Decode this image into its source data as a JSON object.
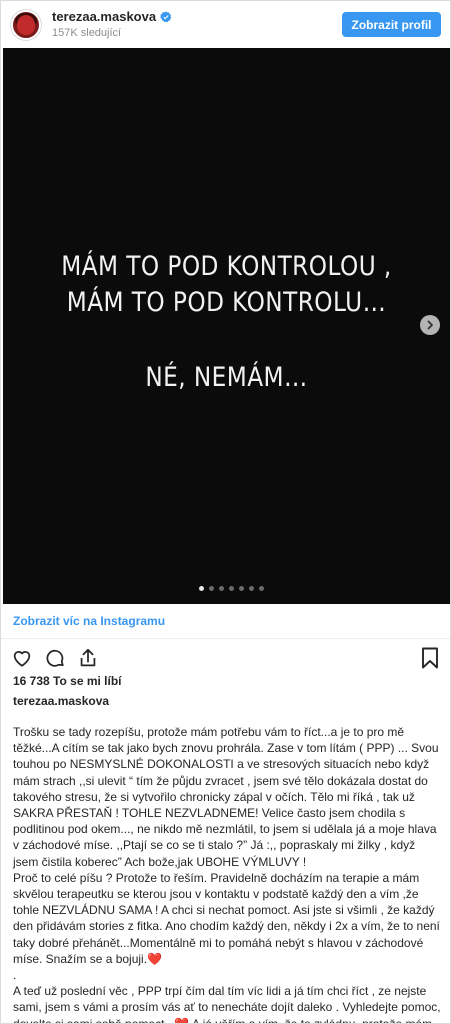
{
  "header": {
    "username": "terezaa.maskova",
    "followers": "157K sledující",
    "profile_button": "Zobrazit profil"
  },
  "slide": {
    "line1": "MÁM TO POD KONTROLOU ,",
    "line2": "MÁM TO POD KONTROLU…",
    "line3": "NÉ, NEMÁM…",
    "dot_count": 7,
    "active_dot": 1
  },
  "view_more": "Zobrazit víc na Instagramu",
  "likes": "16 738 To se mi líbí",
  "author": "terezaa.maskova",
  "caption": "Trošku se tady rozepíšu, protože mám potřebu vám to říct...a je to pro mě těžké...A cítím se tak jako bych znovu prohrála. Zase v tom lítám ( PPP) ... Svou touhou po NESMYSLNÉ DOKONALOSTI a ve stresových situacích nebo když mám strach ,,si ulevit “ tím že půjdu zvracet , jsem své tělo dokázala dostat do takového stresu, že si vytvořilo chronicky zápal v očích. Tělo mi říká , tak už SAKRA PŘESTAŇ ! TOHLE NEZVLADNEME! Velice často jsem chodila s podlitinou pod okem..., ne nikdo mě nezmlátil, to jsem si udělala já a moje hlava v záchodové míse. ,,Ptají se co se ti stalo ?” Já :,, popraskaly mi žilky , když jsem čistila koberec” Ach bože,jak UBOHE VÝMLUVY !\nProč to celé píšu ? Protože to řeším. Pravidelně docházím na terapie a mám skvělou terapeutku se kterou jsou v kontaktu v podstatě každý den a vím ,že tohle NEZVLÁDNU SAMA ! A chci si nechat pomoct. Asi jste si všimli , že každý den přidávám stories z fitka. Ano chodím každý den, někdy i 2x a vím, že to není taky dobré přehánět...Momentálně mi to pomáhá nebýt s hlavou v záchodové míse. Snažím se a bojuji.❤️\n.\nA teď už poslední věc , PPP trpí čím dal tím víc lidi a já tím chci říct , ze nejste sami, jsem s vámi a prosím vás ať to nenecháte dojít daleko . Vyhledejte pomoc, dovolte si sami sobě pomoct . ❤️ A já věřím a vím, že to zvládnu, protože mám kolem sebe lidi , kteří mě milují a podporují. ❤️ Jsem s vámi❤️",
  "icons": [
    "heart-icon",
    "comment-icon",
    "share-icon",
    "bookmark-icon",
    "verified-icon",
    "chevron-right-icon"
  ],
  "colors": {
    "accent": "#3897f0",
    "media_bg": "#0b0b0b",
    "verified": "#3897f0"
  }
}
